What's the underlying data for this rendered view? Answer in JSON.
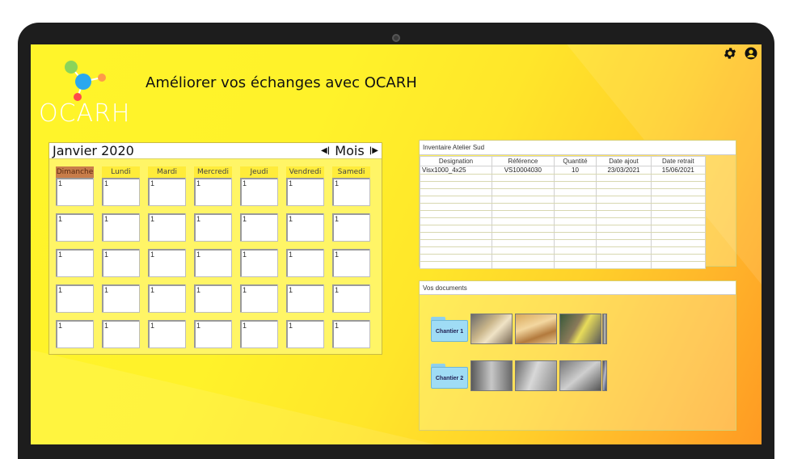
{
  "app": {
    "logo_text": "OCARH",
    "tagline": "Améliorer vos échanges avec OCARH"
  },
  "topbar": {
    "icons": [
      "gear-icon",
      "user-icon"
    ]
  },
  "calendar": {
    "month_label": "Janvier 2020",
    "view_label": "Mois",
    "days": [
      "Dimanche",
      "Lundi",
      "Mardi",
      "Mercredi",
      "Jeudi",
      "Vendredi",
      "Samedi"
    ],
    "active_day": "Dimanche",
    "cell_value": "1",
    "rows": 5
  },
  "inventory": {
    "title": "Inventaire Atelier Sud",
    "columns": [
      "Designation",
      "Référence",
      "Quantité",
      "Date ajout",
      "Date retrait"
    ],
    "rows": [
      [
        "Visx1000_4x25",
        "VS10004030",
        "10",
        "23/03/2021",
        "15/06/2021"
      ]
    ],
    "empty_rows": 13
  },
  "documents": {
    "title": "Vos documents",
    "folders": [
      {
        "label": "Chantier 1",
        "thumbnails": 4
      },
      {
        "label": "Chantier 2",
        "thumbnails": 4
      }
    ]
  },
  "colors": {
    "background_yellow": "#fff42a",
    "background_orange": "#ff9a22",
    "active_day": "#c87d4a",
    "folder_blue": "#9fdcf5",
    "logo_green": "#8bd45a",
    "logo_blue": "#2aa8ee",
    "logo_orange": "#ff9a4a",
    "logo_red": "#ff4a4a"
  }
}
